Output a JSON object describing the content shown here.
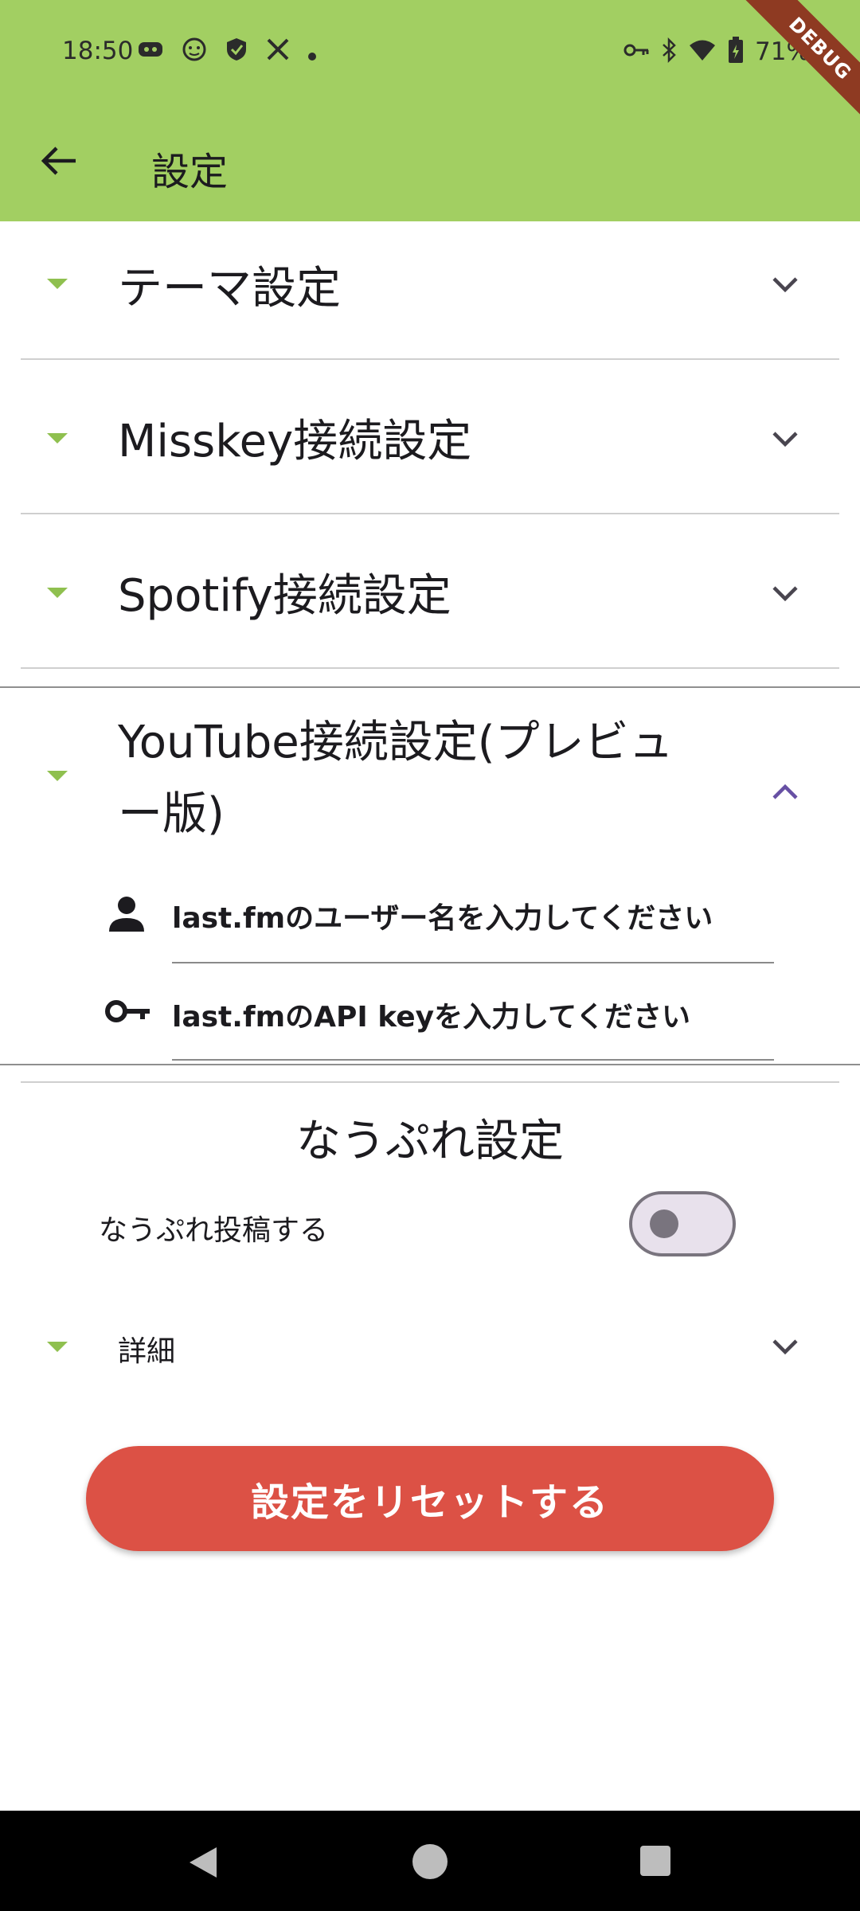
{
  "status_bar": {
    "time": "18:50",
    "battery": "71%"
  },
  "debug_label": "DEBUG",
  "app_bar": {
    "title": "設定"
  },
  "sections": [
    {
      "title": "テーマ設定",
      "expanded": false
    },
    {
      "title": "Misskey接続設定",
      "expanded": false
    },
    {
      "title": "Spotify接続設定",
      "expanded": false
    },
    {
      "title_line1": "YouTube接続設定(プレビュ",
      "title_line2": "ー版)",
      "expanded": true
    }
  ],
  "youtube_inputs": {
    "username_placeholder": "last.fmのユーザー名を入力してください",
    "api_key_placeholder": "last.fmのAPI keyを入力してください"
  },
  "nowplaying": {
    "title": "なうぷれ設定",
    "toggle_label": "なうぷれ投稿する",
    "toggle_on": false,
    "details_label": "詳細"
  },
  "reset_button": "設定をリセットする",
  "colors": {
    "appbar": "#a2cf62",
    "accent_triangle": "#8fc04f",
    "reset": "#dc5145",
    "expanded_chevron": "#6750a4"
  },
  "icons": [
    "back-arrow-icon",
    "chevron-down-icon",
    "chevron-up-icon",
    "person-icon",
    "key-icon",
    "nav-back-icon",
    "nav-home-icon",
    "nav-recents-icon"
  ]
}
